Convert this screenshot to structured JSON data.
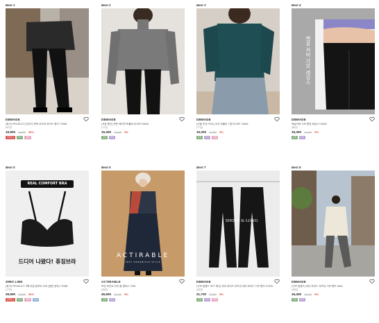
{
  "colors": {
    "discount": "#e0463b",
    "tag_green": "#7fae7c",
    "tag_purple": "#b6a2d4",
    "tag_pink": "#e7a6c0",
    "tag_blue": "#8fb3d6",
    "tag_red": "#d9534f"
  },
  "products": [
    {
      "rank": "Best 1",
      "brand": "DBMADE",
      "name": "(특가) PRODUCT] 빈티지 핀턱 부츠컷 와이드 팬츠 T296B",
      "reviews": "(92건)",
      "price": "19,900",
      "original": "39,800",
      "discount": "50%",
      "tags": [
        {
          "label": "당일출고",
          "color": "red"
        },
        {
          "label": "특가",
          "color": "green"
        },
        {
          "label": "세일",
          "color": "pink"
        }
      ]
    },
    {
      "rank": "Best 2",
      "brand": "DBMADE",
      "name": "(코튼 원단) 쫀쫀 베이직 목폴라 티셔츠 K6644",
      "reviews": "(77건)",
      "price": "15,300",
      "original": "17,000",
      "discount": "9%",
      "tags": [
        {
          "label": "당일",
          "color": "green"
        },
        {
          "label": "특가",
          "color": "purple"
        }
      ]
    },
    {
      "rank": "Best 3",
      "brand": "DBMADE",
      "name": "(긴팔 추천 PICK) 무지 반폴라 기본 티셔츠 T268A",
      "reviews": "(77건)",
      "price": "15,300",
      "original": "17,000",
      "discount": "9%",
      "tags": [
        {
          "label": "당일",
          "color": "green"
        },
        {
          "label": "특가",
          "color": "purple"
        },
        {
          "label": "세일",
          "color": "pink"
        }
      ]
    },
    {
      "rank": "Best 4",
      "brand": "DBMADE",
      "name": "뱃살커버 기모 밴딩 레깅스 K0600",
      "reviews": "(58건)",
      "price": "15,300",
      "original": "17,000",
      "discount": "9%",
      "tags": [
        {
          "label": "당일",
          "color": "green"
        },
        {
          "label": "특가",
          "color": "purple"
        }
      ]
    },
    {
      "rank": "Best 5",
      "brand": "ZIMO LINE",
      "name": "(특가) PRODUCT 3팩 리얼 컴포트 브라 (편한 정착) T296B",
      "reviews": "(77건)",
      "price": "29,900",
      "original": "59,800",
      "discount": "50%",
      "tags": [
        {
          "label": "당일출고",
          "color": "red"
        },
        {
          "label": "특가",
          "color": "green"
        },
        {
          "label": "세일",
          "color": "pink"
        },
        {
          "label": "신상",
          "color": "blue"
        }
      ]
    },
    {
      "rank": "Best 6",
      "brand": "ACTIRABLE",
      "name": "모던 포인트 카라 롱 원피스 T260",
      "reviews": "(66건)",
      "price": "45,600",
      "original": "50,100",
      "discount": "9%",
      "tags": [
        {
          "label": "당일",
          "color": "green"
        },
        {
          "label": "특가",
          "color": "purple"
        }
      ]
    },
    {
      "rank": "Best 7",
      "brand": "DBMADE",
      "name": "(기모 뒷밴드 SET 매주) 하이 와이드 부츠컷 세미 와이드 기모 팬츠 K7028",
      "reviews": "(28건)",
      "price": "21,700",
      "original": "23,800",
      "discount": "9%",
      "tags": [
        {
          "label": "당일",
          "color": "green"
        },
        {
          "label": "특가",
          "color": "purple"
        },
        {
          "label": "세일",
          "color": "pink"
        }
      ]
    },
    {
      "rank": "Best 8",
      "brand": "DBMADE",
      "name": "(기모 뒷밴드) 하이 와이드 부츠컷 기모 팬츠 K681",
      "reviews": "(28건)",
      "price": "16,400",
      "original": "18,000",
      "discount": "9%",
      "tags": [
        {
          "label": "당일",
          "color": "green"
        },
        {
          "label": "특가",
          "color": "purple"
        }
      ]
    }
  ],
  "image_text": {
    "bra_banner": "REAL COMFORT BRA",
    "bra_caption": "드디어 나왔다! 퓨징브라",
    "dress_logo": "ACTIRABLE",
    "dress_sub": "LEFT CHRONICLE STYLE",
    "pants_label": "SHORT & LONG",
    "leggings_vertical": "뱃살 커버 기모 레깅스"
  }
}
